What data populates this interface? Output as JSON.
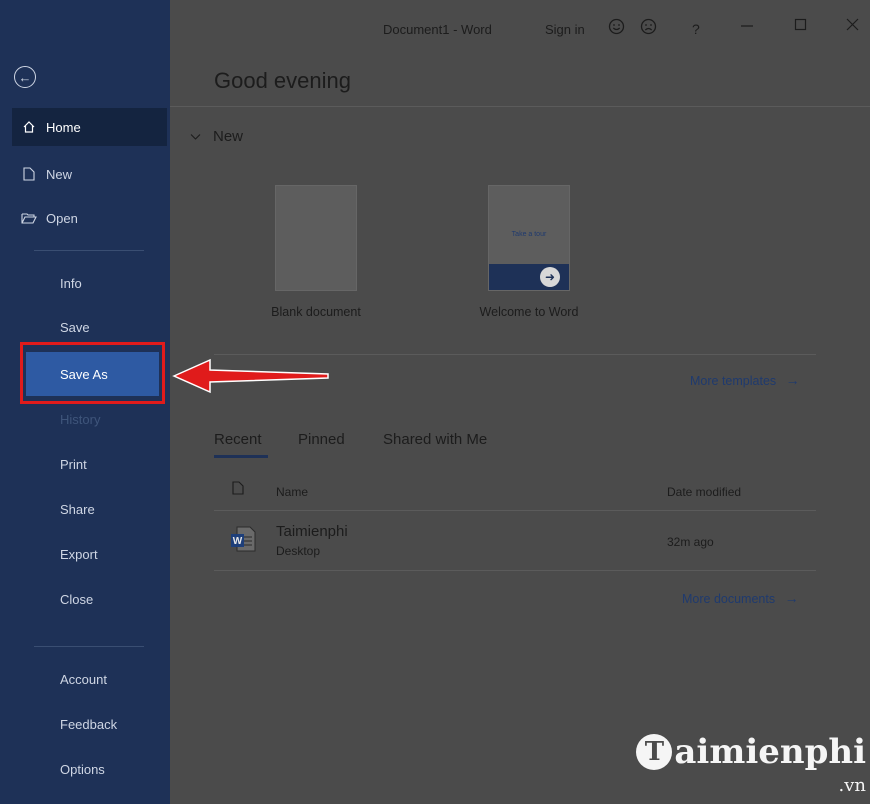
{
  "window": {
    "title": "Document1  -  Word",
    "sign_in": "Sign in",
    "help": "?"
  },
  "sidebar": {
    "items": [
      {
        "label": "Home"
      },
      {
        "label": "New"
      },
      {
        "label": "Open"
      },
      {
        "label": "Info"
      },
      {
        "label": "Save"
      },
      {
        "label": "Save As"
      },
      {
        "label": "History"
      },
      {
        "label": "Print"
      },
      {
        "label": "Share"
      },
      {
        "label": "Export"
      },
      {
        "label": "Close"
      },
      {
        "label": "Account"
      },
      {
        "label": "Feedback"
      },
      {
        "label": "Options"
      }
    ]
  },
  "main": {
    "greeting": "Good evening",
    "new_section": "New",
    "templates": [
      {
        "label": "Blank document"
      },
      {
        "label": "Welcome to Word",
        "preview_text": "Take a tour"
      }
    ],
    "more_templates": "More templates",
    "tabs": [
      "Recent",
      "Pinned",
      "Shared with Me"
    ],
    "columns": {
      "name": "Name",
      "date": "Date modified"
    },
    "documents": [
      {
        "name": "Taimienphi",
        "location": "Desktop",
        "date": "32m ago"
      }
    ],
    "more_documents": "More documents"
  },
  "watermark": {
    "text": "aimienphi",
    "suffix": ".vn"
  },
  "colors": {
    "sidebar": "#1e3157",
    "highlight": "#e01b1b",
    "selected": "#2e5aa3"
  }
}
